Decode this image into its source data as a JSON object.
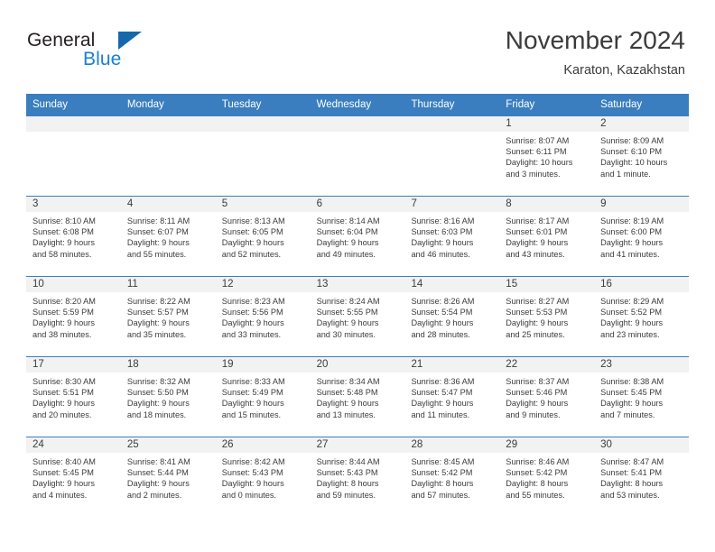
{
  "brand": {
    "name_part1": "General",
    "name_part2": "Blue",
    "triangle_icon": "triangle-icon",
    "accent_color": "#1a7fd4",
    "header_color": "#3a7ebf"
  },
  "header": {
    "title": "November 2024",
    "subtitle": "Karaton, Kazakhstan"
  },
  "calendar": {
    "weekdays": [
      "Sunday",
      "Monday",
      "Tuesday",
      "Wednesday",
      "Thursday",
      "Friday",
      "Saturday"
    ],
    "weeks": [
      [
        {
          "day": "",
          "empty": true
        },
        {
          "day": "",
          "empty": true
        },
        {
          "day": "",
          "empty": true
        },
        {
          "day": "",
          "empty": true
        },
        {
          "day": "",
          "empty": true
        },
        {
          "day": "1",
          "sunrise": "Sunrise: 8:07 AM",
          "sunset": "Sunset: 6:11 PM",
          "daylight1": "Daylight: 10 hours",
          "daylight2": "and 3 minutes."
        },
        {
          "day": "2",
          "sunrise": "Sunrise: 8:09 AM",
          "sunset": "Sunset: 6:10 PM",
          "daylight1": "Daylight: 10 hours",
          "daylight2": "and 1 minute."
        }
      ],
      [
        {
          "day": "3",
          "sunrise": "Sunrise: 8:10 AM",
          "sunset": "Sunset: 6:08 PM",
          "daylight1": "Daylight: 9 hours",
          "daylight2": "and 58 minutes."
        },
        {
          "day": "4",
          "sunrise": "Sunrise: 8:11 AM",
          "sunset": "Sunset: 6:07 PM",
          "daylight1": "Daylight: 9 hours",
          "daylight2": "and 55 minutes."
        },
        {
          "day": "5",
          "sunrise": "Sunrise: 8:13 AM",
          "sunset": "Sunset: 6:05 PM",
          "daylight1": "Daylight: 9 hours",
          "daylight2": "and 52 minutes."
        },
        {
          "day": "6",
          "sunrise": "Sunrise: 8:14 AM",
          "sunset": "Sunset: 6:04 PM",
          "daylight1": "Daylight: 9 hours",
          "daylight2": "and 49 minutes."
        },
        {
          "day": "7",
          "sunrise": "Sunrise: 8:16 AM",
          "sunset": "Sunset: 6:03 PM",
          "daylight1": "Daylight: 9 hours",
          "daylight2": "and 46 minutes."
        },
        {
          "day": "8",
          "sunrise": "Sunrise: 8:17 AM",
          "sunset": "Sunset: 6:01 PM",
          "daylight1": "Daylight: 9 hours",
          "daylight2": "and 43 minutes."
        },
        {
          "day": "9",
          "sunrise": "Sunrise: 8:19 AM",
          "sunset": "Sunset: 6:00 PM",
          "daylight1": "Daylight: 9 hours",
          "daylight2": "and 41 minutes."
        }
      ],
      [
        {
          "day": "10",
          "sunrise": "Sunrise: 8:20 AM",
          "sunset": "Sunset: 5:59 PM",
          "daylight1": "Daylight: 9 hours",
          "daylight2": "and 38 minutes."
        },
        {
          "day": "11",
          "sunrise": "Sunrise: 8:22 AM",
          "sunset": "Sunset: 5:57 PM",
          "daylight1": "Daylight: 9 hours",
          "daylight2": "and 35 minutes."
        },
        {
          "day": "12",
          "sunrise": "Sunrise: 8:23 AM",
          "sunset": "Sunset: 5:56 PM",
          "daylight1": "Daylight: 9 hours",
          "daylight2": "and 33 minutes."
        },
        {
          "day": "13",
          "sunrise": "Sunrise: 8:24 AM",
          "sunset": "Sunset: 5:55 PM",
          "daylight1": "Daylight: 9 hours",
          "daylight2": "and 30 minutes."
        },
        {
          "day": "14",
          "sunrise": "Sunrise: 8:26 AM",
          "sunset": "Sunset: 5:54 PM",
          "daylight1": "Daylight: 9 hours",
          "daylight2": "and 28 minutes."
        },
        {
          "day": "15",
          "sunrise": "Sunrise: 8:27 AM",
          "sunset": "Sunset: 5:53 PM",
          "daylight1": "Daylight: 9 hours",
          "daylight2": "and 25 minutes."
        },
        {
          "day": "16",
          "sunrise": "Sunrise: 8:29 AM",
          "sunset": "Sunset: 5:52 PM",
          "daylight1": "Daylight: 9 hours",
          "daylight2": "and 23 minutes."
        }
      ],
      [
        {
          "day": "17",
          "sunrise": "Sunrise: 8:30 AM",
          "sunset": "Sunset: 5:51 PM",
          "daylight1": "Daylight: 9 hours",
          "daylight2": "and 20 minutes."
        },
        {
          "day": "18",
          "sunrise": "Sunrise: 8:32 AM",
          "sunset": "Sunset: 5:50 PM",
          "daylight1": "Daylight: 9 hours",
          "daylight2": "and 18 minutes."
        },
        {
          "day": "19",
          "sunrise": "Sunrise: 8:33 AM",
          "sunset": "Sunset: 5:49 PM",
          "daylight1": "Daylight: 9 hours",
          "daylight2": "and 15 minutes."
        },
        {
          "day": "20",
          "sunrise": "Sunrise: 8:34 AM",
          "sunset": "Sunset: 5:48 PM",
          "daylight1": "Daylight: 9 hours",
          "daylight2": "and 13 minutes."
        },
        {
          "day": "21",
          "sunrise": "Sunrise: 8:36 AM",
          "sunset": "Sunset: 5:47 PM",
          "daylight1": "Daylight: 9 hours",
          "daylight2": "and 11 minutes."
        },
        {
          "day": "22",
          "sunrise": "Sunrise: 8:37 AM",
          "sunset": "Sunset: 5:46 PM",
          "daylight1": "Daylight: 9 hours",
          "daylight2": "and 9 minutes."
        },
        {
          "day": "23",
          "sunrise": "Sunrise: 8:38 AM",
          "sunset": "Sunset: 5:45 PM",
          "daylight1": "Daylight: 9 hours",
          "daylight2": "and 7 minutes."
        }
      ],
      [
        {
          "day": "24",
          "sunrise": "Sunrise: 8:40 AM",
          "sunset": "Sunset: 5:45 PM",
          "daylight1": "Daylight: 9 hours",
          "daylight2": "and 4 minutes."
        },
        {
          "day": "25",
          "sunrise": "Sunrise: 8:41 AM",
          "sunset": "Sunset: 5:44 PM",
          "daylight1": "Daylight: 9 hours",
          "daylight2": "and 2 minutes."
        },
        {
          "day": "26",
          "sunrise": "Sunrise: 8:42 AM",
          "sunset": "Sunset: 5:43 PM",
          "daylight1": "Daylight: 9 hours",
          "daylight2": "and 0 minutes."
        },
        {
          "day": "27",
          "sunrise": "Sunrise: 8:44 AM",
          "sunset": "Sunset: 5:43 PM",
          "daylight1": "Daylight: 8 hours",
          "daylight2": "and 59 minutes."
        },
        {
          "day": "28",
          "sunrise": "Sunrise: 8:45 AM",
          "sunset": "Sunset: 5:42 PM",
          "daylight1": "Daylight: 8 hours",
          "daylight2": "and 57 minutes."
        },
        {
          "day": "29",
          "sunrise": "Sunrise: 8:46 AM",
          "sunset": "Sunset: 5:42 PM",
          "daylight1": "Daylight: 8 hours",
          "daylight2": "and 55 minutes."
        },
        {
          "day": "30",
          "sunrise": "Sunrise: 8:47 AM",
          "sunset": "Sunset: 5:41 PM",
          "daylight1": "Daylight: 8 hours",
          "daylight2": "and 53 minutes."
        }
      ]
    ]
  }
}
